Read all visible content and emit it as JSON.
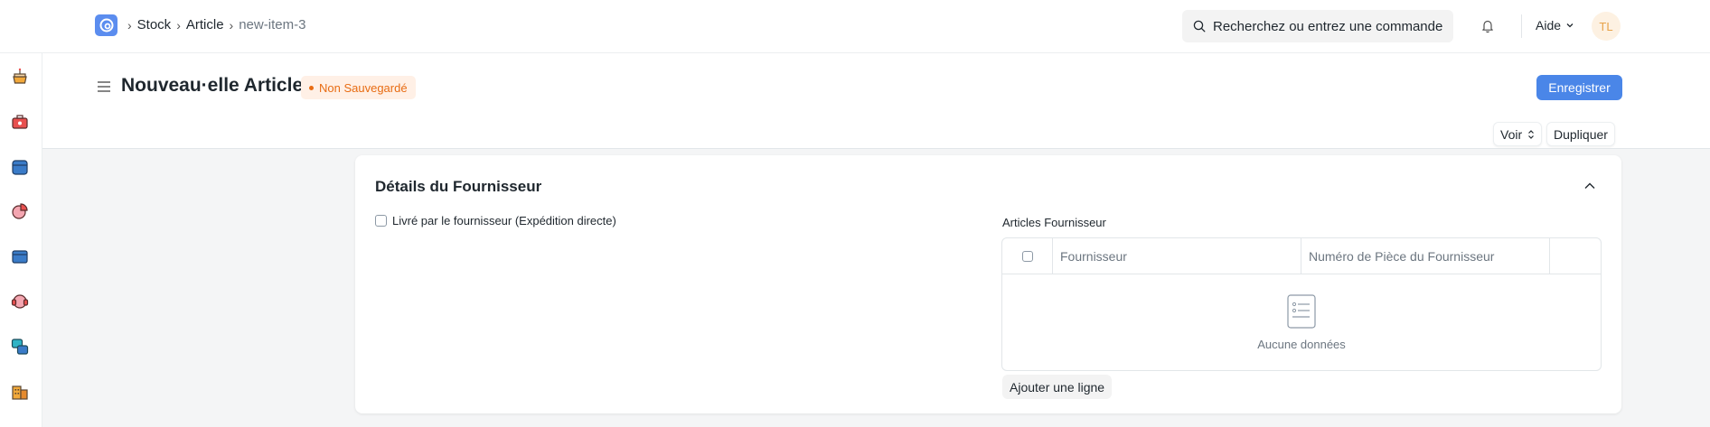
{
  "navbar": {
    "breadcrumbs": [
      "Stock",
      "Article",
      "new-item-3"
    ],
    "search_placeholder": "Recherchez ou entrez une commande",
    "help_label": "Aide",
    "avatar_initials": "TL"
  },
  "sidebar": {
    "icons": [
      "cake-icon",
      "toolbox-icon",
      "box-icon",
      "pie-chart-icon",
      "wallet-icon",
      "headset-icon",
      "layers-icon",
      "building-icon"
    ]
  },
  "page": {
    "title": "Nouveau·elle Article",
    "status_indicator": "Non Sauvegardé",
    "save_label": "Enregistrer",
    "view_label": "Voir",
    "duplicate_label": "Dupliquer"
  },
  "section": {
    "title": "Détails du Fournisseur",
    "checkbox_label": "Livré par le fournisseur (Expédition directe)",
    "table_label": "Articles Fournisseur",
    "columns": [
      "Fournisseur",
      "Numéro de Pièce du Fournisseur"
    ],
    "empty_text": "Aucune données",
    "add_row_label": "Ajouter une ligne"
  },
  "colors": {
    "primary": "#4a86e8",
    "unsaved": "#e86c13",
    "avatar_bg": "#fdf1e2"
  }
}
